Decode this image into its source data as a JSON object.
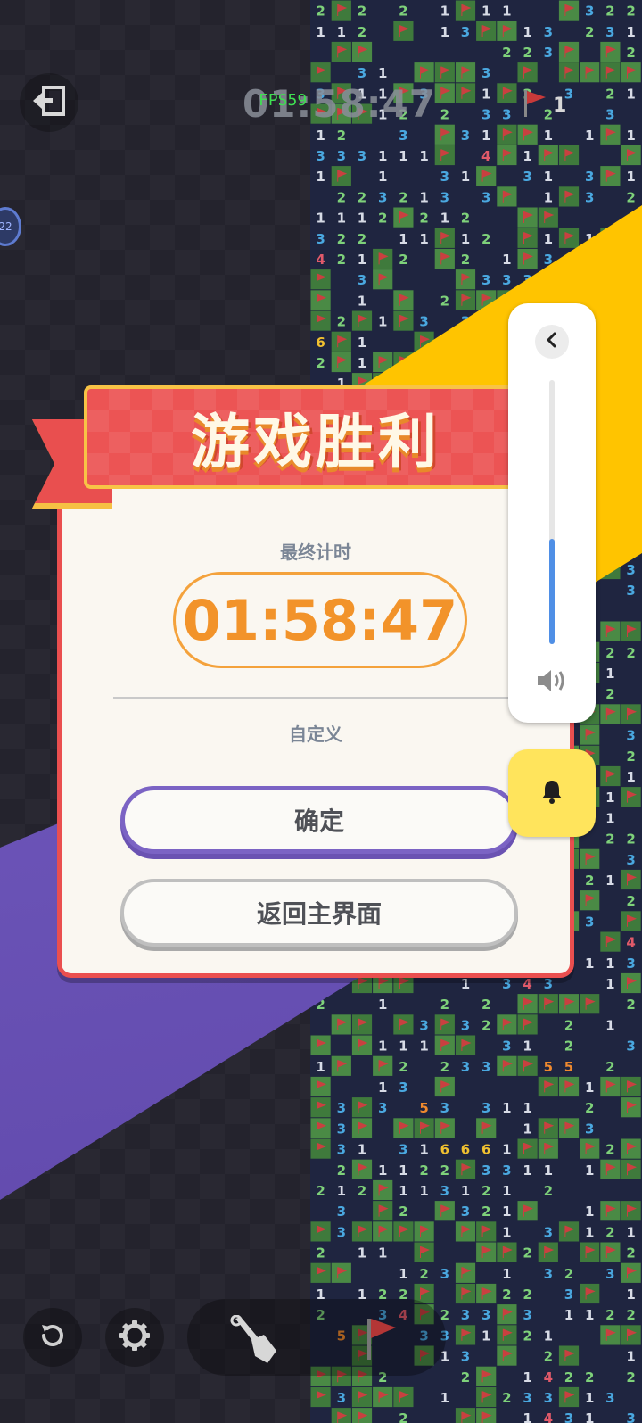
{
  "top_bar": {
    "timer": "01:58:47",
    "fps": "FPS59",
    "flag_count": "1",
    "side_badge": "22"
  },
  "dialog": {
    "title": "游戏胜利",
    "final_time_label": "最终计时",
    "final_time": "01:58:47",
    "mode_label": "自定义",
    "confirm_label": "确定",
    "home_label": "返回主界面"
  },
  "volume": {
    "level": 0.4
  },
  "colors": {
    "ribbon": "#ec5454",
    "ribbon_border": "#f8c346",
    "time_orange": "#f2932a",
    "confirm_border": "#7b63c4",
    "bell_bg": "#ffe45c",
    "volume_fill": "#4f8fe6",
    "band_yellow": "#ffc400",
    "band_purple": "#6e57bd",
    "fps_green": "#3fdf52"
  },
  "icons": {
    "exit": "exit-icon",
    "flag": "flag-icon",
    "restart": "restart-icon",
    "settings": "gear-icon",
    "shovel": "shovel-icon",
    "volume": "speaker-icon",
    "bell": "bell-icon",
    "collapse": "chevron-left-icon"
  }
}
